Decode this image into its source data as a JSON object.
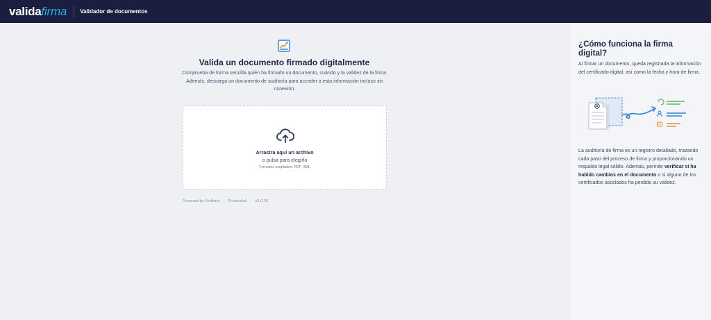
{
  "header": {
    "logo_part1": "valida",
    "logo_part2": "firma",
    "title": "Validador de documentos"
  },
  "main": {
    "title": "Valida un documento firmado digitalmente",
    "description": "Comprueba de forma sencilla quién ha firmado un documento, cuándo y la validez de la firma. Además, descarga un documento de auditoría para acceder a esta información incluso sin conexión.",
    "dropzone": {
      "primary": "Arrastra aquí un archivo",
      "secondary": "o pulsa para elegirlo",
      "formats": "Formatos aceptados: PDF, XML"
    },
    "footer": {
      "powered": "Powered by Viafirma",
      "privacy": "Privacidad",
      "version": "v3.0.25",
      "separator": "·"
    }
  },
  "sidebar": {
    "title": "¿Cómo funciona la firma digital?",
    "paragraph1": "Al firmar un documento, queda registrada la información del certificado digital, así como la fecha y hora de firma.",
    "paragraph2_start": "La auditoría de firma es un registro detallado, trazando cada paso del proceso de firma y proporcionando un respaldo legal sólido. Además, permite ",
    "paragraph2_bold": "verificar si ha habido cambios en el documento",
    "paragraph2_end": " o si alguno de los certificados asociados ha perdido su validez."
  },
  "icons": {
    "document": "document-signature-icon",
    "upload": "cloud-upload-icon",
    "illustration": "signature-flow-illustration"
  },
  "colors": {
    "header_bg": "#1a1f40",
    "brand_blue": "#29a9e0",
    "accent_green": "#5cb85c",
    "accent_blue": "#2f7fd1",
    "accent_orange": "#e8893a"
  }
}
